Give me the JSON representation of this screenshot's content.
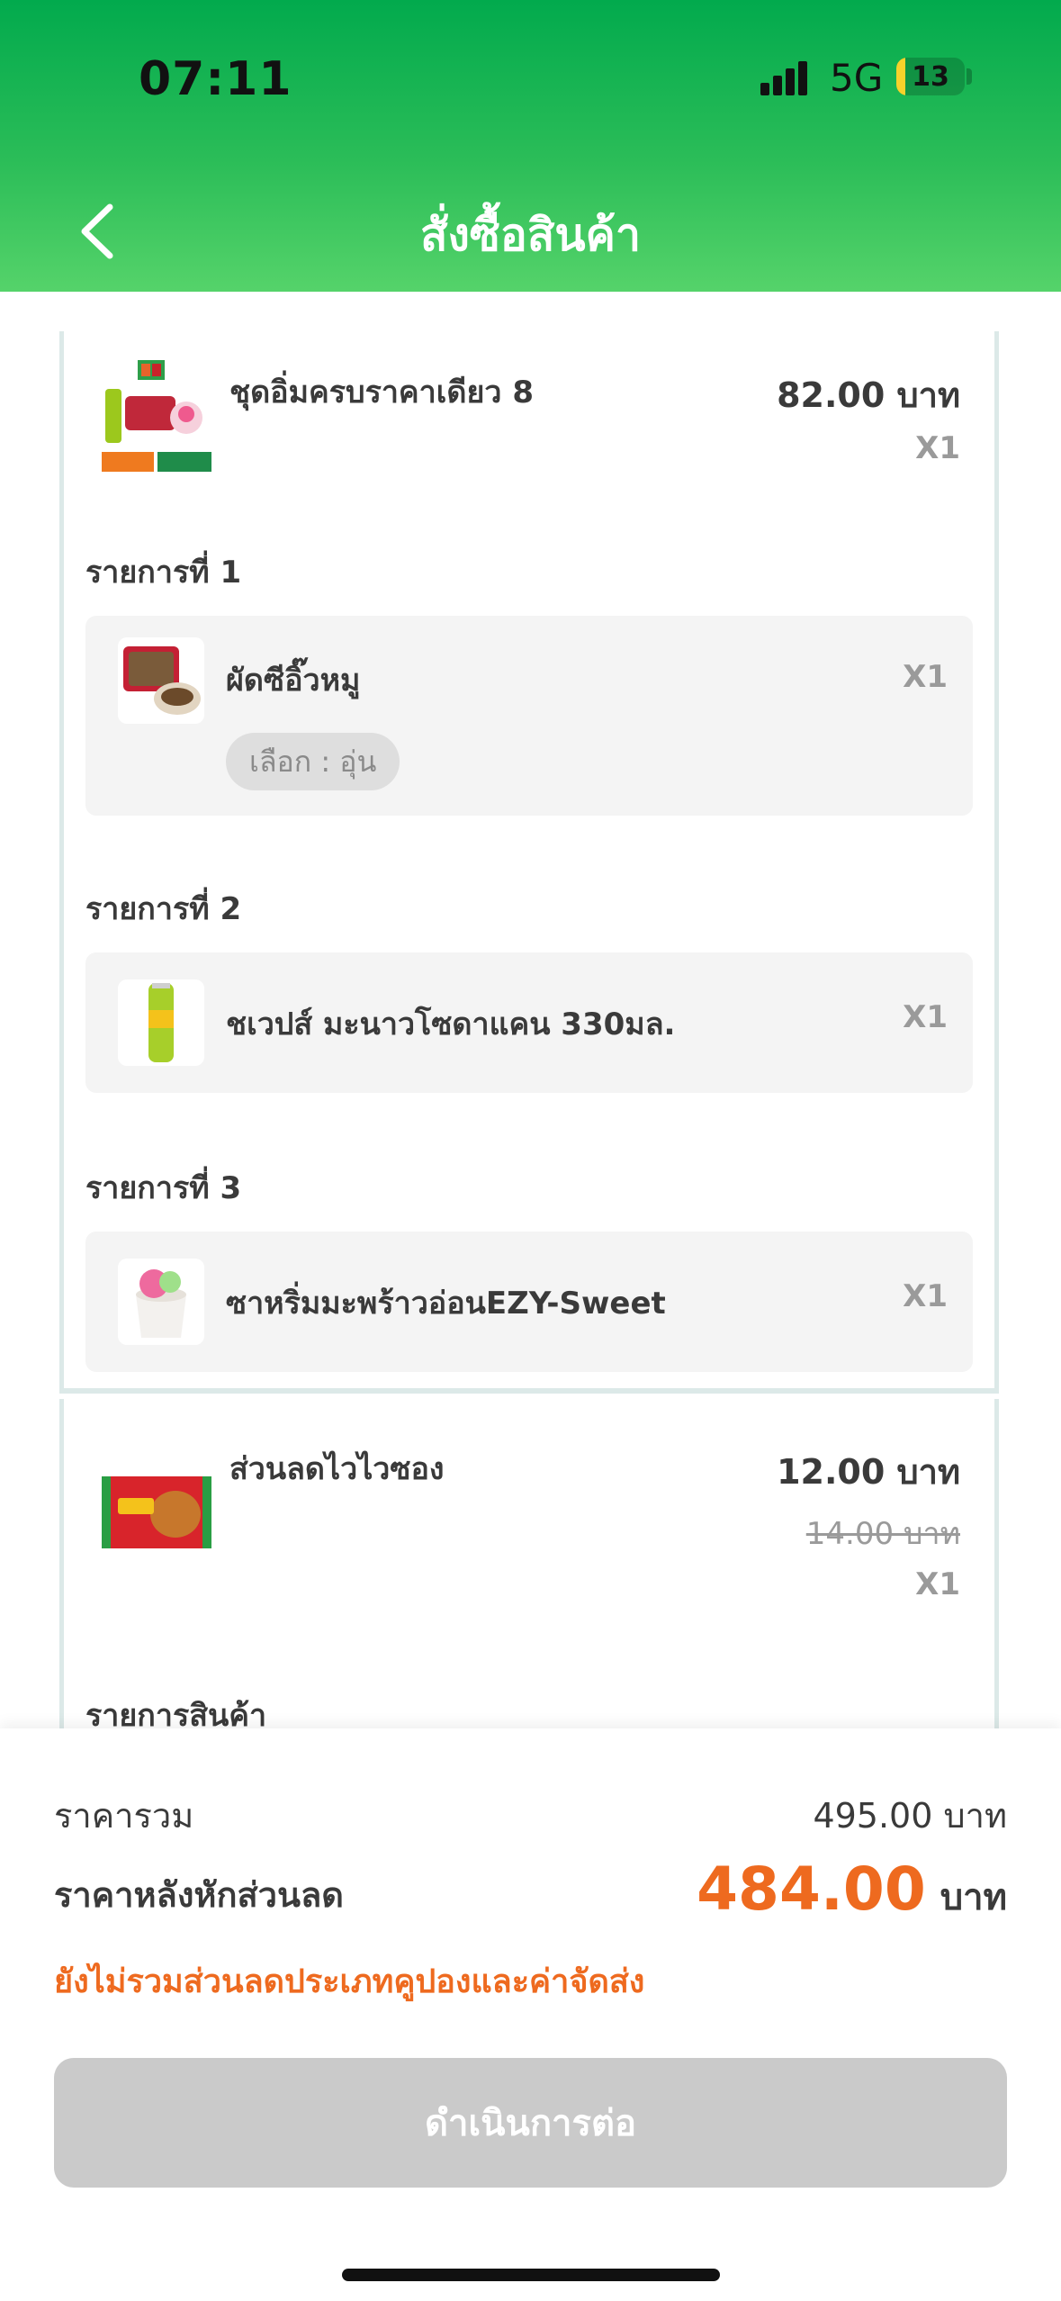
{
  "status_bar": {
    "time": "07:11",
    "network": "5G",
    "battery": "13",
    "battery_fraction": 0.13
  },
  "header": {
    "title": "สั่งซื้อสินค้า",
    "back_icon": "chevron-left-icon"
  },
  "bundle": {
    "name": "ชุดอิ่มครบราคาเดียว 8",
    "price": "82.00 บาท",
    "qty": "X1",
    "items": [
      {
        "label": "รายการที่ 1",
        "name": "ผัดซีอิ๊วหมู",
        "qty": "X1",
        "option": "เลือก : อุ่น"
      },
      {
        "label": "รายการที่ 2",
        "name": "ชเวปส์ มะนาวโซดาแคน 330มล.",
        "qty": "X1"
      },
      {
        "label": "รายการที่ 3",
        "name": "ซาหริ่มมะพร้าวอ่อนEZY-Sweet",
        "qty": "X1"
      }
    ]
  },
  "discount_item": {
    "name": "ส่วนลดไวไวซอง",
    "price": "12.00 บาท",
    "old_price": "14.00 บาท",
    "qty": "X1",
    "section_label": "รายการสินค้า"
  },
  "summary": {
    "total_label": "ราคารวม",
    "total_value": "495.00 บาท",
    "final_label": "ราคาหลังหักส่วนลด",
    "final_amount": "484.00",
    "final_unit": "บาท",
    "note": "ยังไม่รวมส่วนลดประเภทคูปองและค่าจัดส่ง",
    "cta_label": "ดำเนินการต่อ"
  },
  "colors": {
    "header_green": "#02aa4d",
    "accent_orange": "#ee6a1f",
    "disabled_button": "#cacaca"
  }
}
